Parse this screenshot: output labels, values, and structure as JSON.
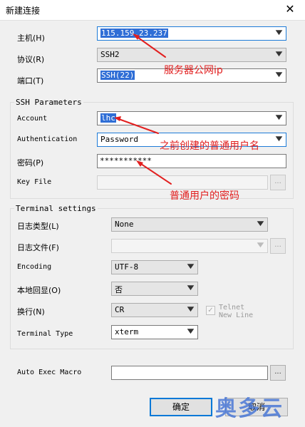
{
  "window": {
    "title": "新建连接",
    "close_glyph": "✕"
  },
  "form": {
    "host_label": "主机(H)",
    "host_value": "115.159.23.237",
    "protocol_label": "协议(R)",
    "protocol_value": "SSH2",
    "port_label": "端口(T)",
    "port_value": "SSH(22)"
  },
  "ssh": {
    "title": "SSH Parameters",
    "account_label": "Account",
    "account_value": "lhc",
    "auth_label": "Authentication",
    "auth_value": "Password",
    "password_label": "密码(P)",
    "password_value": "***********",
    "keyfile_label": "Key File",
    "keyfile_value": "",
    "browse": "..."
  },
  "terminal": {
    "title": "Terminal settings",
    "logtype_label": "日志类型(L)",
    "logtype_value": "None",
    "logfile_label": "日志文件(F)",
    "logfile_value": "",
    "encoding_label": "Encoding",
    "encoding_value": "UTF-8",
    "echo_label": "本地回显(O)",
    "echo_value": "否",
    "newline_label": "换行(N)",
    "newline_value": "CR",
    "telnet_newline_label_1": "Telnet",
    "telnet_newline_label_2": "New Line",
    "termtype_label": "Terminal Type",
    "termtype_value": "xterm",
    "browse": "..."
  },
  "macro": {
    "label": "Auto Exec Macro",
    "value": "",
    "browse": "..."
  },
  "buttons": {
    "ok": "确定",
    "cancel": "取消"
  },
  "annotations": {
    "server_ip": "服务器公网ip",
    "username": "之前创建的普通用户名",
    "password": "普通用户的密码",
    "color": "#e22020"
  },
  "watermark": "奥多云"
}
